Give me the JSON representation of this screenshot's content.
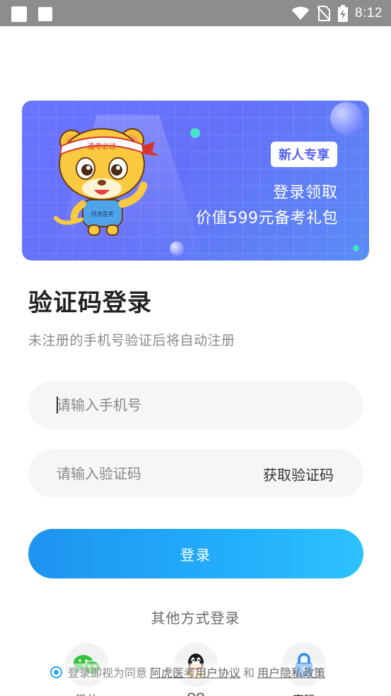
{
  "status_bar": {
    "time": "8:12",
    "icons": [
      "notification-square-icon",
      "notification-square-icon",
      "wifi-icon",
      "no-sim-icon",
      "battery-charging-icon"
    ]
  },
  "banner": {
    "badge": "新人专享",
    "line1": "登录领取",
    "line2": "价值599元备考礼包",
    "mascot_headband": "逢考必过",
    "mascot_shirt": "阿虎医考"
  },
  "page": {
    "title": "验证码登录",
    "subtitle": "未注册的手机号验证后将自动注册"
  },
  "form": {
    "phone_placeholder": "请输入手机号",
    "code_placeholder": "请输入验证码",
    "get_code_label": "获取验证码",
    "login_label": "登录"
  },
  "other_login": {
    "heading": "其他方式登录",
    "methods": [
      {
        "icon": "wechat-icon",
        "label": "微信"
      },
      {
        "icon": "qq-icon",
        "label": "QQ"
      },
      {
        "icon": "lock-icon",
        "label": "密码"
      }
    ]
  },
  "agreement": {
    "prefix": "登录即视为同意",
    "user_agreement": "阿虎医考用户协议",
    "and": "和",
    "privacy_policy": "用户隐私政策"
  },
  "colors": {
    "primary": "#23aefb",
    "banner": "#6570f8",
    "accent_teal": "#44e3c8"
  }
}
